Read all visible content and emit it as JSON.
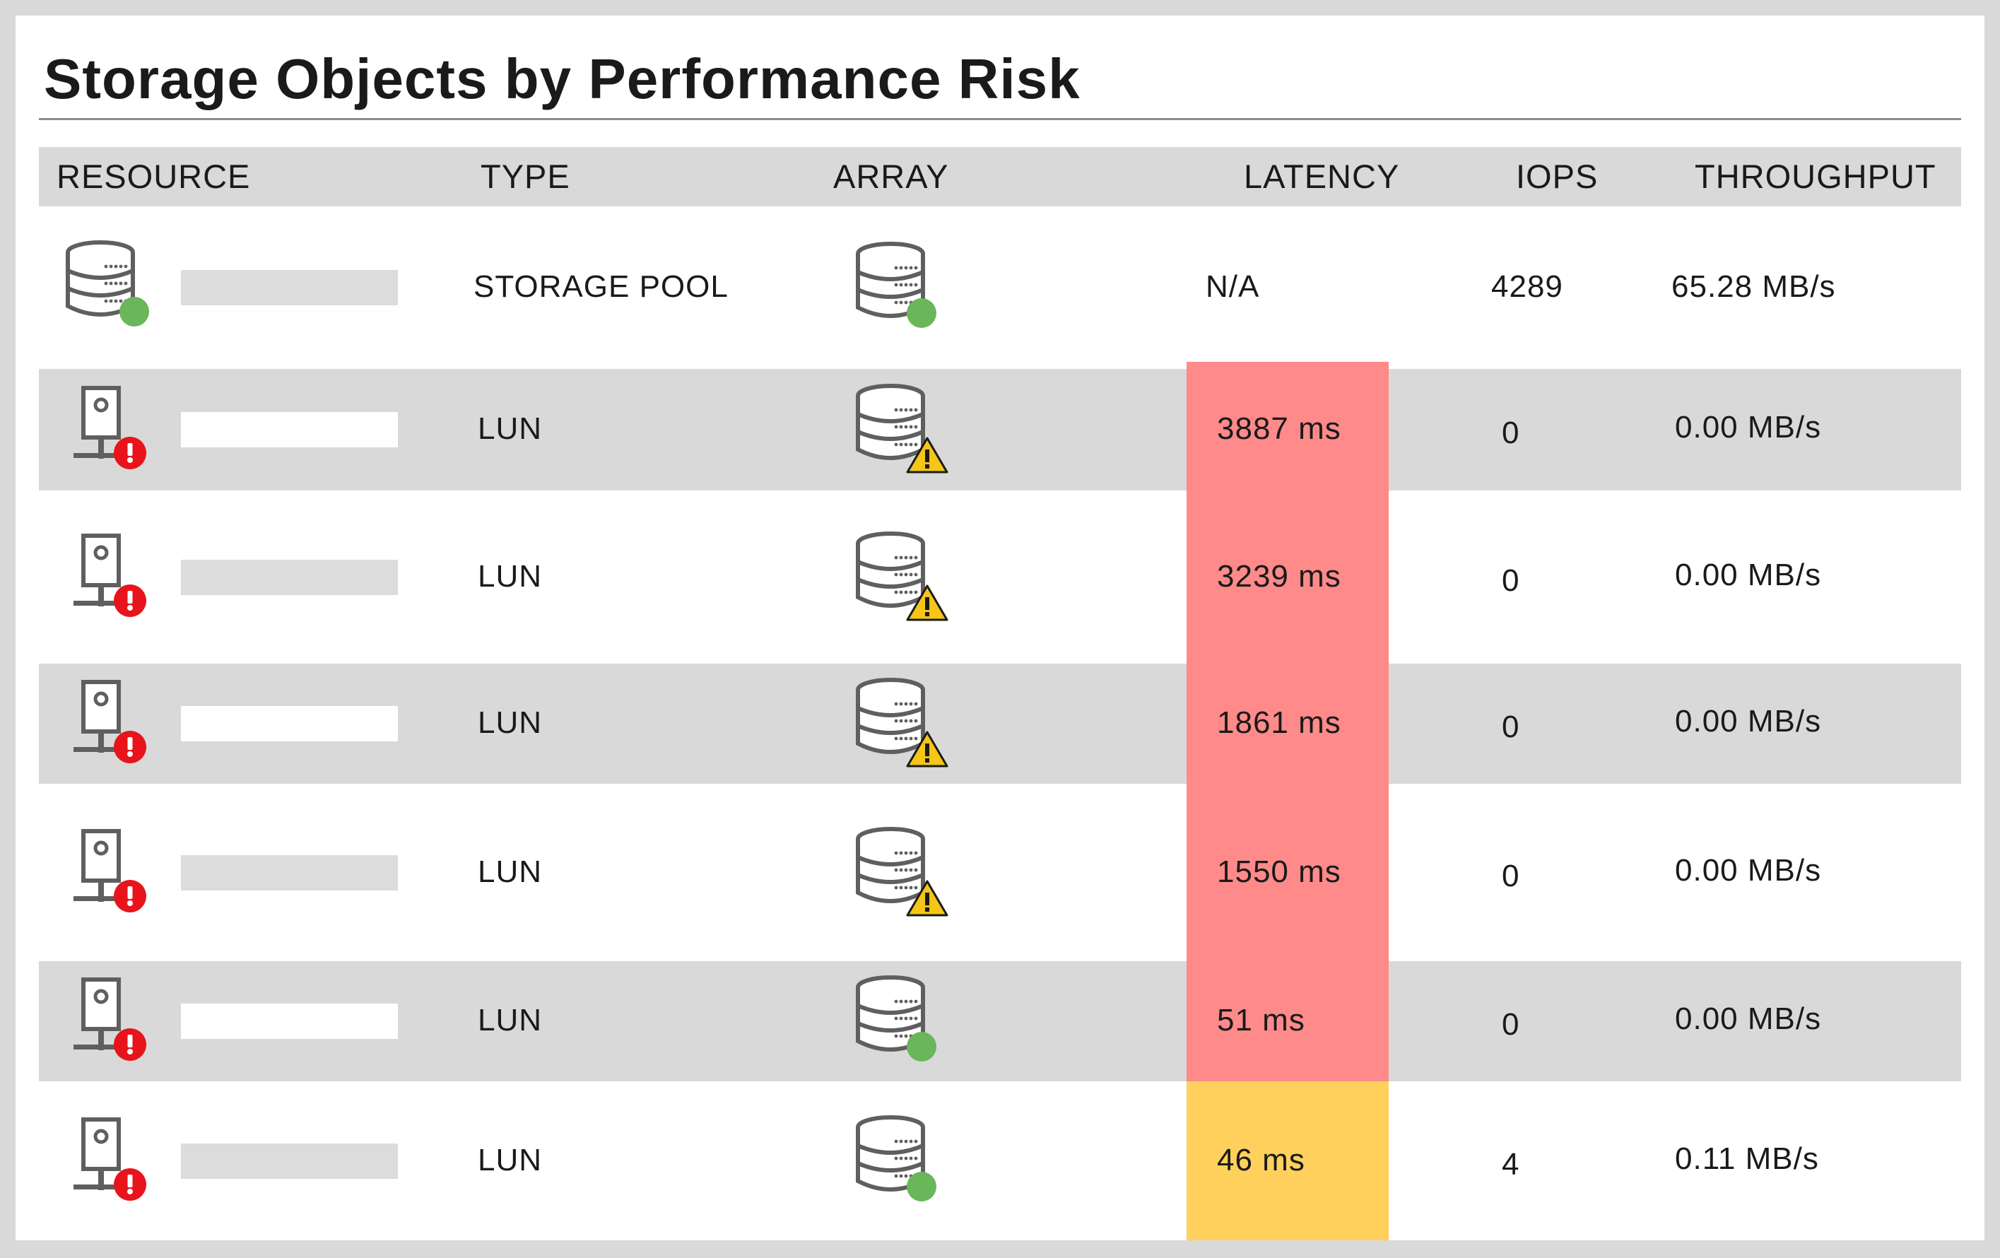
{
  "title": "Storage Objects by Performance Risk",
  "columns": {
    "resource": "RESOURCE",
    "type": "TYPE",
    "array": "ARRAY",
    "latency": "LATENCY",
    "iops": "IOPS",
    "throughput": "THROUGHPUT"
  },
  "colors": {
    "critical": "#ff8a8a",
    "warning": "#ffd05c",
    "ok_status": "#6ab65a",
    "error_status": "#e8141b",
    "warn_icon": "#f5c518",
    "shade": "#d9d9d9"
  },
  "rows": [
    {
      "resource_icon": "storage-pool-icon",
      "resource_status": "ok",
      "type": "STORAGE POOL",
      "array_status": "ok",
      "latency": "N/A",
      "latency_level": "none",
      "iops": "4289",
      "throughput": "65.28 MB/s"
    },
    {
      "resource_icon": "lun-icon",
      "resource_status": "error",
      "type": "LUN",
      "array_status": "warning",
      "latency": "3887 ms",
      "latency_level": "critical",
      "iops": "0",
      "throughput": "0.00 MB/s"
    },
    {
      "resource_icon": "lun-icon",
      "resource_status": "error",
      "type": "LUN",
      "array_status": "warning",
      "latency": "3239 ms",
      "latency_level": "critical",
      "iops": "0",
      "throughput": "0.00 MB/s"
    },
    {
      "resource_icon": "lun-icon",
      "resource_status": "error",
      "type": "LUN",
      "array_status": "warning",
      "latency": "1861 ms",
      "latency_level": "critical",
      "iops": "0",
      "throughput": "0.00 MB/s"
    },
    {
      "resource_icon": "lun-icon",
      "resource_status": "error",
      "type": "LUN",
      "array_status": "warning",
      "latency": "1550 ms",
      "latency_level": "critical",
      "iops": "0",
      "throughput": "0.00 MB/s"
    },
    {
      "resource_icon": "lun-icon",
      "resource_status": "error",
      "type": "LUN",
      "array_status": "ok",
      "latency": "51 ms",
      "latency_level": "critical",
      "iops": "0",
      "throughput": "0.00 MB/s"
    },
    {
      "resource_icon": "lun-icon",
      "resource_status": "error",
      "type": "LUN",
      "array_status": "ok",
      "latency": "46 ms",
      "latency_level": "warning",
      "iops": "4",
      "throughput": "0.11 MB/s"
    }
  ]
}
